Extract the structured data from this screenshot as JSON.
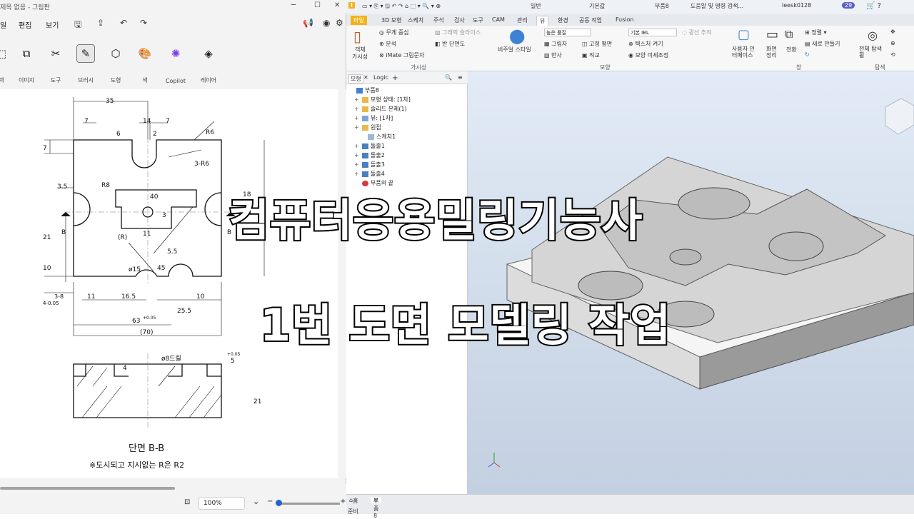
{
  "paint": {
    "title": "제목 없음 - 그림판",
    "menu": {
      "file": "일",
      "edit": "편집",
      "view": "보기"
    },
    "tools": [
      {
        "name": "image-tool",
        "label": "이미지",
        "icon": "image-icon"
      },
      {
        "name": "tools-tool",
        "label": "도구",
        "icon": "tools-icon"
      },
      {
        "name": "brush-tool",
        "label": "브러시",
        "icon": "brush-icon"
      },
      {
        "name": "shapes-tool",
        "label": "도형",
        "icon": "shapes-icon"
      },
      {
        "name": "color-tool",
        "label": "색",
        "icon": "palette-icon"
      },
      {
        "name": "copilot-tool",
        "label": "Copilot",
        "icon": "copilot-icon"
      },
      {
        "name": "layers-tool",
        "label": "레이어",
        "icon": "layers-icon"
      }
    ],
    "zoom": "100%"
  },
  "drawing": {
    "dims": {
      "d35": "35",
      "d7a": "7",
      "d14": "14",
      "d7b": "7",
      "d6": "6",
      "d2": "2",
      "dR6a": "R6",
      "d3R6": "3-R6",
      "d7left": "7",
      "d35b": "3.5",
      "dR8": "R8",
      "d40": "40",
      "d3": "3",
      "d21": "21",
      "dR": "(R)",
      "d11": "11",
      "d55": "5.5",
      "d10": "10",
      "dphi15": "ø15",
      "d45": "45",
      "d005": "4-0.05",
      "d3r": "3-8",
      "d11b": "11",
      "d165": "16.5",
      "d10b": "10",
      "d255": "25.5",
      "d63": "63",
      "d63tol": "+0.05",
      "d70": "(70)",
      "dB": "B",
      "dphi8": "ø8드릴",
      "d4": "4",
      "d5": "5",
      "d5tol": "+0.05",
      "d21b": "21",
      "d18": "18"
    },
    "section": "단면 B-B",
    "note": "※도시되고 지시없는 R은 R2"
  },
  "inventor": {
    "title": {
      "mode": "일반",
      "defaults": "기본값",
      "part": "부품8",
      "search": "도움말 및 명령 검색...",
      "user": "leesk0128",
      "badge": "29"
    },
    "tabs": [
      "파일",
      "3D 모형",
      "스케치",
      "주석",
      "검사",
      "도구",
      "CAM",
      "관리",
      "뷰",
      "환경",
      "공동 작업",
      "Fusion"
    ],
    "active_tab": "뷰",
    "ribbon": {
      "visibility": {
        "object": "객체",
        "visible": "가시성",
        "gravity": "무게 중심",
        "analysis": "분석",
        "imate": "iMate 그림문자",
        "slice": "그래픽 슬라이스",
        "half": "반 단면도",
        "group": "가시성"
      },
      "appearance": {
        "visual": "비주얼 스타일",
        "quality": "높은 품질",
        "shadow": "그림자",
        "reflect": "반사",
        "fixed": "고정 평면",
        "ortho": "직교",
        "ibl": "기본 IBL",
        "raytrace": "광선 추적",
        "texture": "텍스처 켜기",
        "tune": "모양 미세조정",
        "group": "모양"
      },
      "window": {
        "ui": "사용자 인터페이스",
        "clean": "화면 정리",
        "switch": "전환",
        "arrange": "정렬",
        "newwin": "새로 만들기",
        "group": "창"
      },
      "nav": {
        "full": "전체 탐색 휠",
        "group": "탐색"
      }
    },
    "browser": {
      "tabs": [
        "모형",
        "Logic"
      ],
      "nodes": [
        {
          "label": "부품8",
          "depth": 0,
          "icon": "part-icon",
          "expand": ""
        },
        {
          "label": "모형 상태: [1차]",
          "depth": 1,
          "icon": "folder-icon",
          "expand": "+"
        },
        {
          "label": "솔리드 본체(1)",
          "depth": 1,
          "icon": "folder-icon",
          "expand": "+"
        },
        {
          "label": "뷰: [1차]",
          "depth": 1,
          "icon": "view-icon",
          "expand": "+"
        },
        {
          "label": "원점",
          "depth": 1,
          "icon": "folder-icon",
          "expand": "+"
        },
        {
          "label": "스케치1",
          "depth": 2,
          "icon": "sketch-icon",
          "expand": ""
        },
        {
          "label": "돌출1",
          "depth": 1,
          "icon": "extrude-icon",
          "expand": "+"
        },
        {
          "label": "돌출2",
          "depth": 1,
          "icon": "extrude-icon",
          "expand": "+"
        },
        {
          "label": "돌출3",
          "depth": 1,
          "icon": "extrude-icon",
          "expand": "+"
        },
        {
          "label": "돌출4",
          "depth": 1,
          "icon": "extrude-icon",
          "expand": "+"
        },
        {
          "label": "부품의 끝",
          "depth": 1,
          "icon": "end-icon",
          "expand": ""
        }
      ]
    },
    "bottom": {
      "home": "홈",
      "doc": "부품8",
      "status": "준비"
    }
  },
  "overlay": {
    "line1": "컴퓨터응용밀링기능사",
    "line2": "1번 도면 모델링 작업"
  },
  "colors": {
    "accent": "#2563c9",
    "file_tab": "#f2b21a",
    "part": "#d7d7d7"
  }
}
